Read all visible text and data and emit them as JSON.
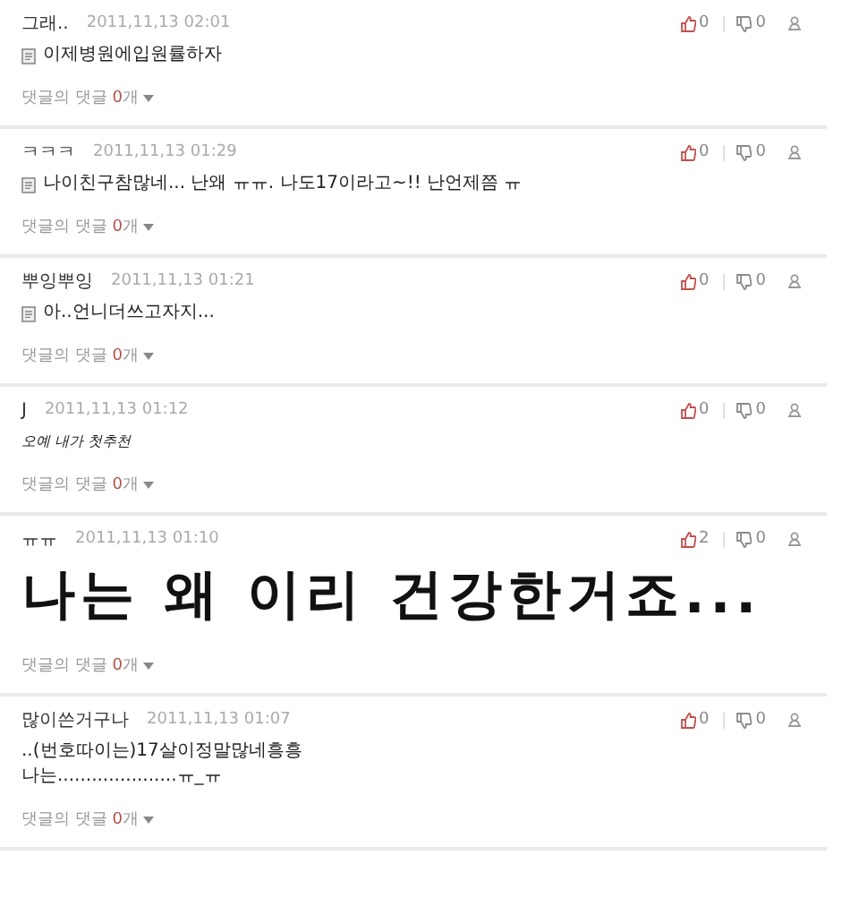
{
  "comments": [
    {
      "author": "그래..",
      "date": "2011,11,13 02:01",
      "likes": "0",
      "dislikes": "0",
      "kind": "memo",
      "lines": [
        "이제병원에입원률하자"
      ],
      "reply": {
        "label": "댓글의 댓글",
        "count": "0",
        "suffix": "개"
      }
    },
    {
      "author": "ㅋㅋㅋ",
      "date": "2011,11,13 01:29",
      "likes": "0",
      "dislikes": "0",
      "kind": "memo",
      "lines": [
        "나이친구참많네... 난왜 ㅠㅠ. 나도17이라고~!! 난언제쯤 ㅠ"
      ],
      "reply": {
        "label": "댓글의 댓글",
        "count": "0",
        "suffix": "개"
      }
    },
    {
      "author": "뿌잉뿌잉",
      "date": "2011,11,13 01:21",
      "likes": "0",
      "dislikes": "0",
      "kind": "memo",
      "lines": [
        "아..언니더쓰고자지..."
      ],
      "reply": {
        "label": "댓글의 댓글",
        "count": "0",
        "suffix": "개"
      }
    },
    {
      "author": "J",
      "date": "2011,11,13 01:12",
      "likes": "0",
      "dislikes": "0",
      "kind": "handwriting",
      "lines": [
        "오예 내가 첫추천"
      ],
      "reply": {
        "label": "댓글의 댓글",
        "count": "0",
        "suffix": "개"
      }
    },
    {
      "author": "ㅠㅠ",
      "date": "2011,11,13 01:10",
      "likes": "2",
      "dislikes": "0",
      "kind": "large",
      "lines": [
        "나는 왜 이리 건강한거죠..."
      ],
      "reply": {
        "label": "댓글의 댓글",
        "count": "0",
        "suffix": "개"
      }
    },
    {
      "author": "많이쓴거구나",
      "date": "2011,11,13 01:07",
      "likes": "0",
      "dislikes": "0",
      "kind": "plain",
      "lines": [
        "..(번호따이는)17살이정말많네흥흥",
        "나는.....................ㅠ_ㅠ"
      ],
      "reply": {
        "label": "댓글의 댓글",
        "count": "0",
        "suffix": "개"
      }
    }
  ]
}
